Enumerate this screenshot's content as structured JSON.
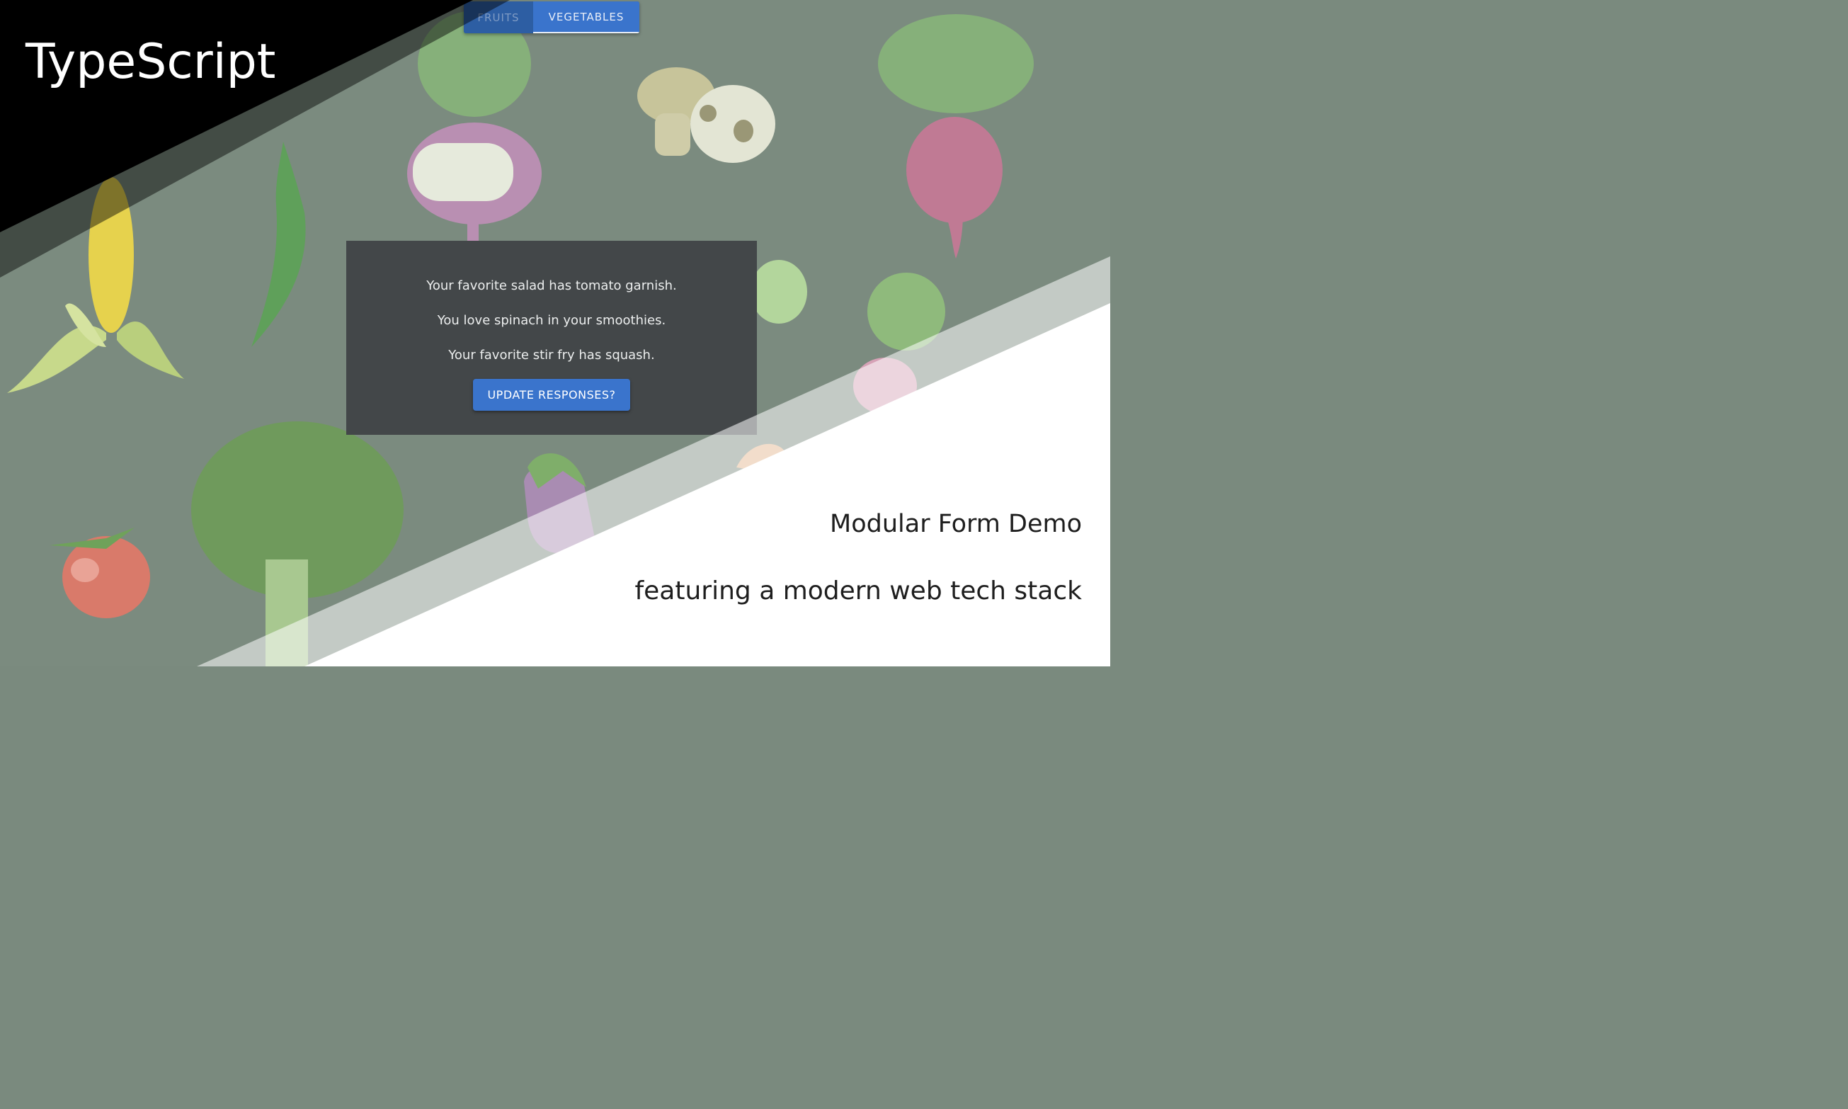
{
  "banner": {
    "title": "TypeScript",
    "subtitle": "Modular Form Demo",
    "tagline": "featuring a modern web tech stack"
  },
  "tabs": [
    {
      "label": "FRUITS",
      "selected": false
    },
    {
      "label": "VEGETABLES",
      "selected": true
    }
  ],
  "card": {
    "lines": [
      "Your favorite salad has tomato garnish.",
      "You love spinach in your smoothies.",
      "Your favorite stir fry has squash."
    ],
    "button_label": "UPDATE RESPONSES?"
  },
  "colors": {
    "accent": "#3a74cc",
    "background": "#7b8b7f",
    "card": "#434749",
    "overlay_dark": "#000000",
    "overlay_light": "#ffffff"
  }
}
